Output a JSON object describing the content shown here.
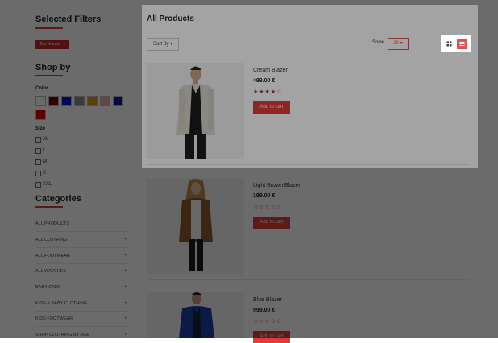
{
  "sidebar": {
    "selected_filters_title": "Selected Filters",
    "filter_tag": {
      "label": "Top Brands",
      "remove": "×"
    },
    "shop_by_title": "Shop by",
    "color_label": "Color",
    "colors": [
      "#ffffff",
      "#7a0000",
      "#0a14c8",
      "#8a8a8a",
      "#d79a00",
      "#e8aab0",
      "#0a1890",
      "#d40000"
    ],
    "size_label": "Size",
    "sizes": [
      "XL",
      "L",
      "M",
      "S",
      "XXL"
    ],
    "categories_title": "Categories",
    "categories": [
      {
        "label": "ALL PRODUCTS",
        "plus": ""
      },
      {
        "label": "ALL CLOTHING",
        "plus": "+"
      },
      {
        "label": "ALL FOOTWEAR",
        "plus": "+"
      },
      {
        "label": "ALL WATCHES",
        "plus": "+"
      },
      {
        "label": "BABY CARE",
        "plus": "+"
      },
      {
        "label": "KIDS & BABY CLOTHING",
        "plus": "+"
      },
      {
        "label": "KIDS FOOTWEAR",
        "plus": "+"
      },
      {
        "label": "SHOP CLOTHING BY AGE",
        "plus": "+"
      }
    ]
  },
  "main": {
    "title": "All Products",
    "sort_label": "Sort By ▾",
    "show_label": "Show",
    "show_value": "20 ▾",
    "accent": "#e03c3c",
    "products": [
      {
        "name": "Cream Blazer",
        "price": "499.00 €",
        "stars": "★★★★☆",
        "button": "Add to cart"
      },
      {
        "name": "Light Brown Blazer",
        "price": "199.00 €",
        "stars": "☆☆☆☆☆",
        "button": "Add to cart"
      },
      {
        "name": "Blue Blazer",
        "price": "999.00 €",
        "stars": "☆☆☆☆☆",
        "button": "Add to cart"
      }
    ]
  }
}
